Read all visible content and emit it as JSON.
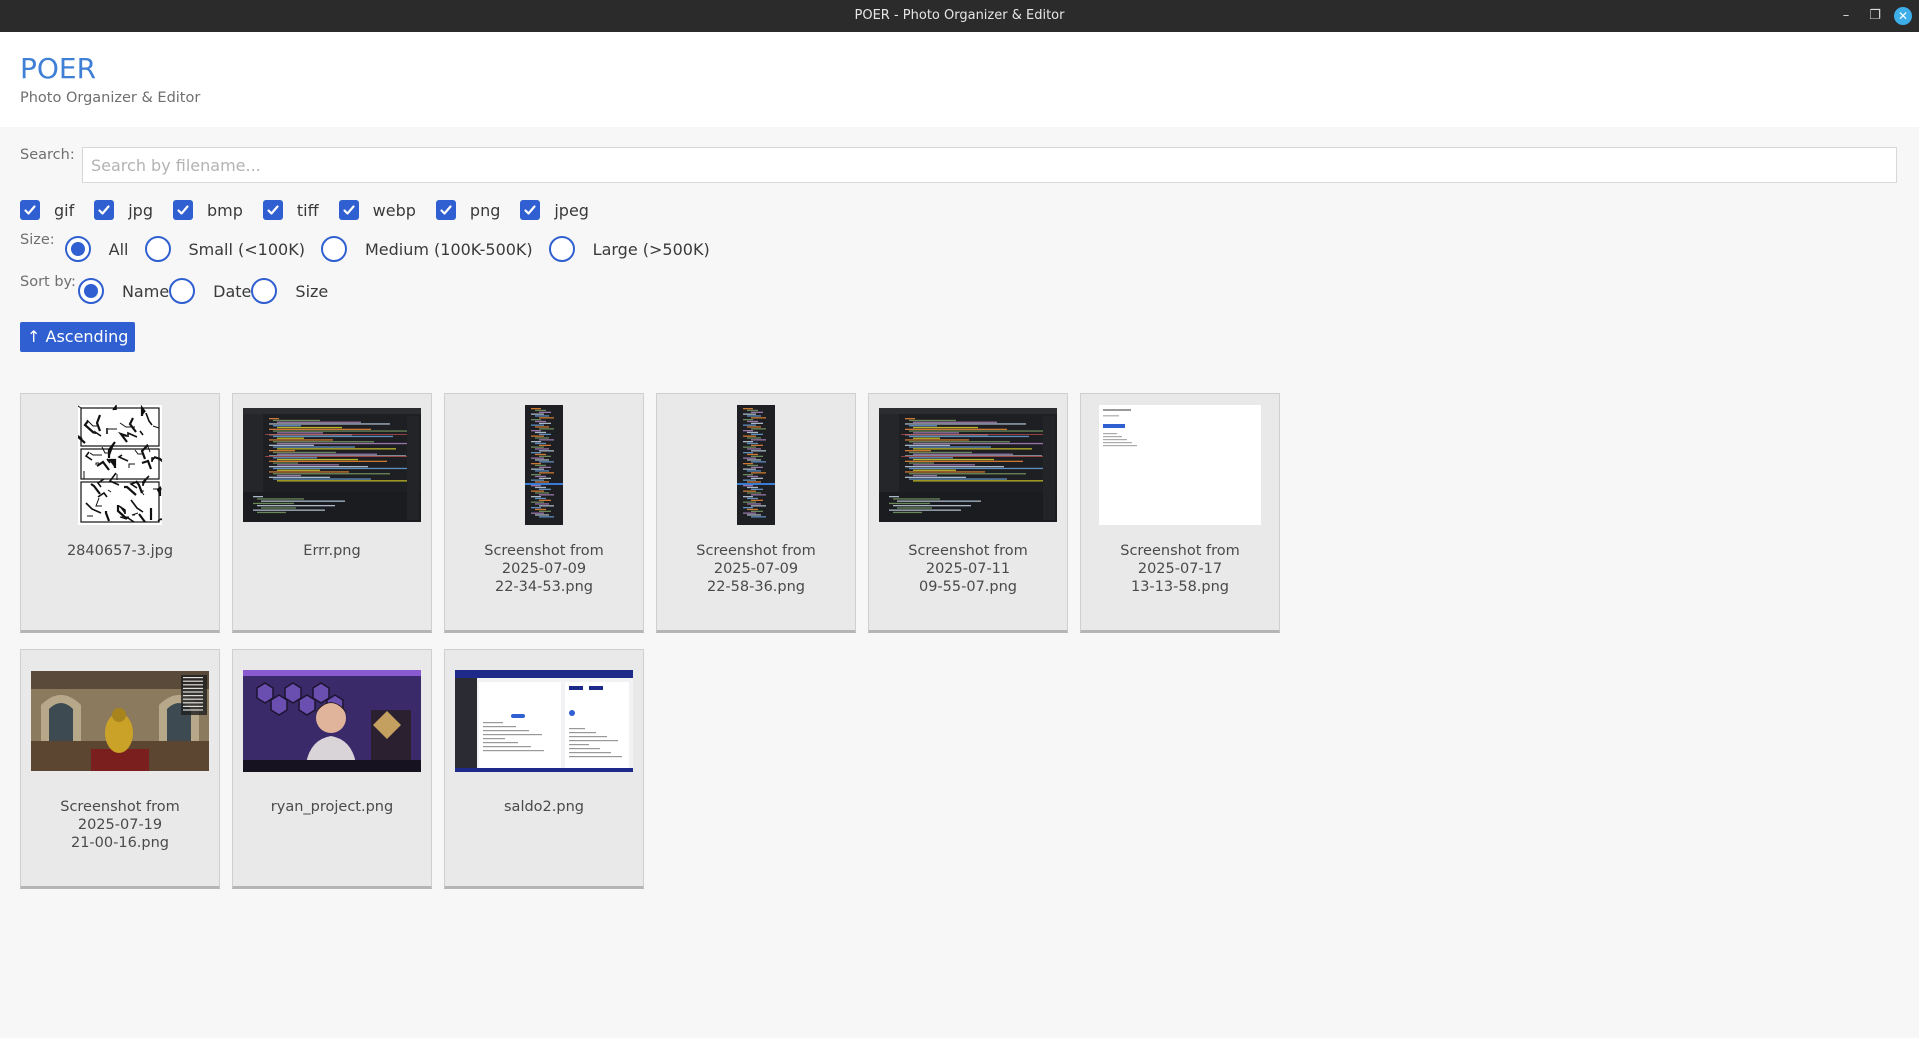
{
  "window": {
    "title": "POER - Photo Organizer & Editor",
    "minimize_glyph": "–",
    "maximize_glyph": "❐",
    "close_glyph": "✕"
  },
  "header": {
    "app_name": "POER",
    "subtitle": "Photo Organizer & Editor"
  },
  "search": {
    "label": "Search:",
    "placeholder": "Search by filename...",
    "value": ""
  },
  "extensions": [
    {
      "label": "gif",
      "checked": true
    },
    {
      "label": "jpg",
      "checked": true
    },
    {
      "label": "bmp",
      "checked": true
    },
    {
      "label": "tiff",
      "checked": true
    },
    {
      "label": "webp",
      "checked": true
    },
    {
      "label": "png",
      "checked": true
    },
    {
      "label": "jpeg",
      "checked": true
    }
  ],
  "size_filter": {
    "label": "Size:",
    "options": [
      "All",
      "Small (<100K)",
      "Medium (100K-500K)",
      "Large (>500K)"
    ],
    "selected": "All"
  },
  "sort": {
    "label": "Sort by:",
    "options": [
      "Name",
      "Date",
      "Size"
    ],
    "selected": "Name",
    "order_button": "↑ Ascending"
  },
  "images": [
    {
      "name": "2840657-3.jpg",
      "thumb": "manga-page"
    },
    {
      "name": "Errr.png",
      "thumb": "dark-code-wide"
    },
    {
      "name": "Screenshot from\n2025-07-09\n22-34-53.png",
      "thumb": "dark-code-tall"
    },
    {
      "name": "Screenshot from\n2025-07-09\n22-58-36.png",
      "thumb": "dark-code-tall"
    },
    {
      "name": "Screenshot from\n2025-07-11\n09-55-07.png",
      "thumb": "dark-code-wide"
    },
    {
      "name": "Screenshot from\n2025-07-17\n13-13-58.png",
      "thumb": "white-page"
    },
    {
      "name": "Screenshot from\n2025-07-19\n21-00-16.png",
      "thumb": "game-scene"
    },
    {
      "name": "ryan_project.png",
      "thumb": "person-purple"
    },
    {
      "name": "saldo2.png",
      "thumb": "web-ui"
    }
  ],
  "colors": {
    "accent": "#2f5fd0",
    "brand_title": "#3f7fd6",
    "titlebar": "#2b2b2b"
  }
}
